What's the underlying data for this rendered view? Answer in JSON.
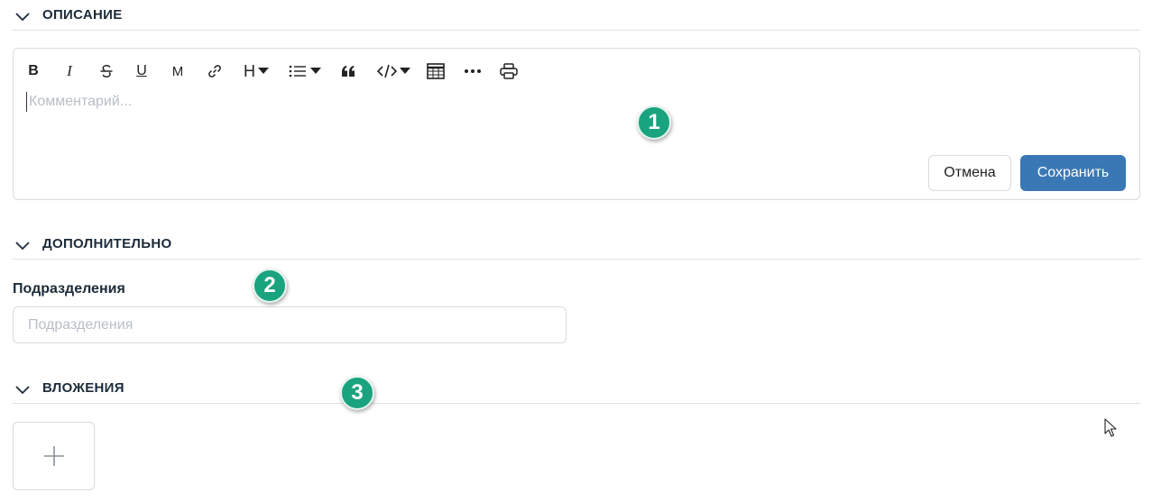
{
  "sections": {
    "description": {
      "title": "ОПИСАНИЕ"
    },
    "additional": {
      "title": "ДОПОЛНИТЕЛЬНО"
    },
    "attachments": {
      "title": "ВЛОЖЕНИЯ"
    }
  },
  "editor": {
    "toolbar": {
      "bold": "B",
      "italic": "I",
      "underline": "U",
      "mention": "M",
      "heading": "H",
      "quote": "“"
    },
    "placeholder": "Комментарий...",
    "cancel_label": "Отмена",
    "save_label": "Сохранить",
    "save_color": "#3a78b5"
  },
  "fields": {
    "departments": {
      "label": "Подразделения",
      "placeholder": "Подразделения",
      "value": ""
    }
  },
  "badges": [
    "1",
    "2",
    "3"
  ],
  "colors": {
    "badge": "#1aa37f",
    "accent": "#3a78b5"
  }
}
